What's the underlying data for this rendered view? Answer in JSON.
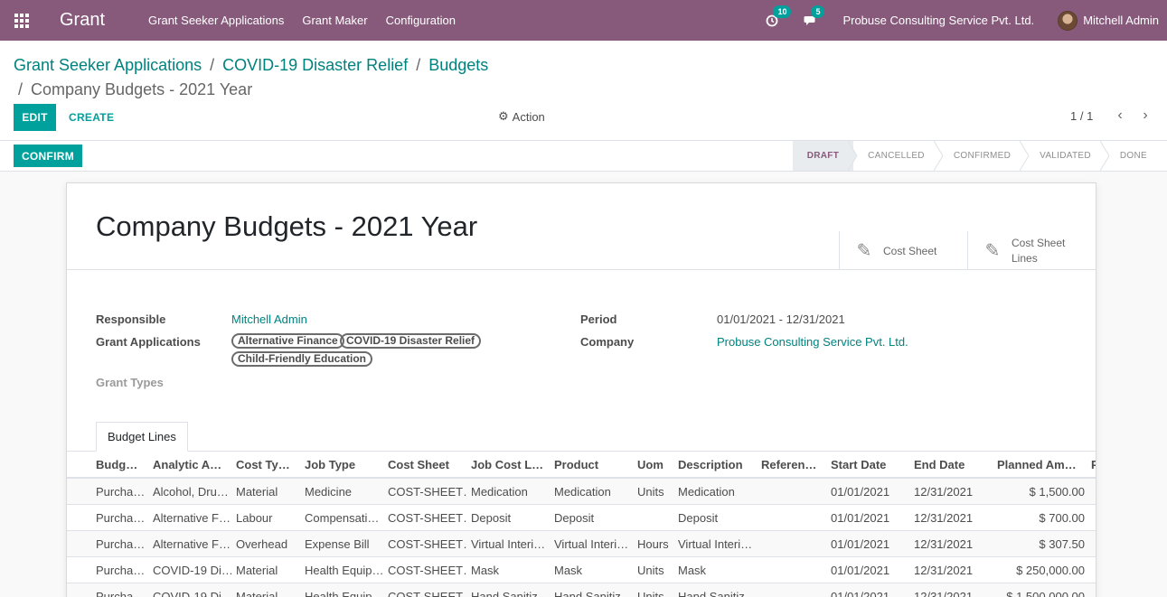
{
  "navbar": {
    "app_name": "Grant",
    "menu": [
      "Grant Seeker Applications",
      "Grant Maker",
      "Configuration"
    ],
    "activity_count": "10",
    "message_count": "5",
    "company": "Probuse Consulting Service Pvt. Ltd.",
    "user": "Mitchell Admin"
  },
  "breadcrumb": {
    "items": [
      "Grant Seeker Applications",
      "COVID-19 Disaster Relief",
      "Budgets"
    ],
    "current": "Company Budgets - 2021 Year"
  },
  "controls": {
    "edit": "EDIT",
    "create": "CREATE",
    "action": "Action",
    "pager": "1 / 1"
  },
  "statusbar": {
    "confirm": "CONFIRM",
    "stages": [
      "DRAFT",
      "CANCELLED",
      "CONFIRMED",
      "VALIDATED",
      "DONE"
    ],
    "active_stage": "DRAFT"
  },
  "form": {
    "title": "Company Budgets - 2021 Year",
    "smart_buttons": [
      "Cost Sheet",
      "Cost Sheet Lines"
    ],
    "fields": {
      "responsible_label": "Responsible",
      "responsible": "Mitchell Admin",
      "grant_apps_label": "Grant Applications",
      "grant_apps": [
        "Alternative Finance",
        "COVID-19 Disaster Relief",
        "Child-Friendly Education"
      ],
      "grant_types_label": "Grant Types",
      "period_label": "Period",
      "period": "01/01/2021 - 12/31/2021",
      "company_label": "Company",
      "company": "Probuse Consulting Service Pvt. Ltd."
    },
    "tab": "Budget Lines"
  },
  "table": {
    "columns": [
      "Budg…",
      "Analytic A…",
      "Cost Ty…",
      "Job Type",
      "Cost Sheet",
      "Job Cost L…",
      "Product",
      "Uom",
      "Description",
      "Referen…",
      "Start Date",
      "End Date",
      "Planned Am…",
      "P"
    ],
    "rows": [
      [
        "Purcha…",
        "Alcohol, Dru…",
        "Material",
        "Medicine",
        "COST-SHEET…",
        "Medication",
        "Medication",
        "Units",
        "Medication",
        "",
        "01/01/2021",
        "12/31/2021",
        "$ 1,500.00"
      ],
      [
        "Purcha…",
        "Alternative F…",
        "Labour",
        "Compensati…",
        "COST-SHEET…",
        "Deposit",
        "Deposit",
        "",
        "Deposit",
        "",
        "01/01/2021",
        "12/31/2021",
        "$ 700.00"
      ],
      [
        "Purcha…",
        "Alternative F…",
        "Overhead",
        "Expense Bill",
        "COST-SHEET…",
        "Virtual Interi…",
        "Virtual Interi…",
        "Hours",
        "Virtual Interi…",
        "",
        "01/01/2021",
        "12/31/2021",
        "$ 307.50"
      ],
      [
        "Purcha…",
        "COVID-19 Di…",
        "Material",
        "Health Equip…",
        "COST-SHEET…",
        "Mask",
        "Mask",
        "Units",
        "Mask",
        "",
        "01/01/2021",
        "12/31/2021",
        "$ 250,000.00"
      ],
      [
        "Purcha…",
        "COVID-19 Di…",
        "Material",
        "Health Equip…",
        "COST-SHEET…",
        "Hand Sanitiz…",
        "Hand Sanitiz…",
        "Units",
        "Hand Sanitiz…",
        "",
        "01/01/2021",
        "12/31/2021",
        "$ 1,500,000.00"
      ]
    ]
  }
}
